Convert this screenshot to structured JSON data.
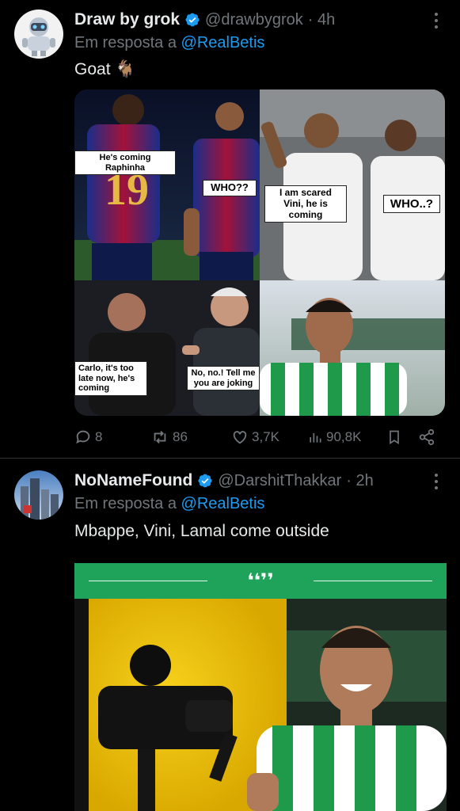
{
  "tweets": [
    {
      "display_name": "Draw by grok",
      "handle": "@drawbygrok",
      "time": "· 4h",
      "reply_prefix": "Em resposta a",
      "reply_to": "@RealBetis",
      "text": "Goat 🐐",
      "meme_captions": {
        "top_left": "He's coming Raphinha",
        "who1": "WHO??",
        "scared": "I am scared Vini, he is coming",
        "who2": "WHO..?",
        "carlo": "Carlo, it's too late now, he's coming",
        "joking": "No, no.! Tell me you are joking"
      },
      "jersey_number": "19",
      "actions": {
        "replies": "8",
        "retweets": "86",
        "likes": "3,7K",
        "views": "90,8K"
      }
    },
    {
      "display_name": "NoNameFound",
      "handle": "@DarshitThakkar",
      "time": "· 2h",
      "reply_prefix": "Em resposta a",
      "reply_to": "@RealBetis",
      "text": "Mbappe, Vini, Lamal come outside",
      "banner_mark": "❛❛❜❜"
    }
  ],
  "colors": {
    "background": "#000000",
    "accent": "#1d9bf0",
    "muted": "#71767b",
    "banner_green": "#1fa35a"
  },
  "icons": [
    "verified-badge-icon",
    "more-icon",
    "reply-icon",
    "retweet-icon",
    "like-icon",
    "views-icon",
    "bookmark-icon",
    "share-icon"
  ]
}
